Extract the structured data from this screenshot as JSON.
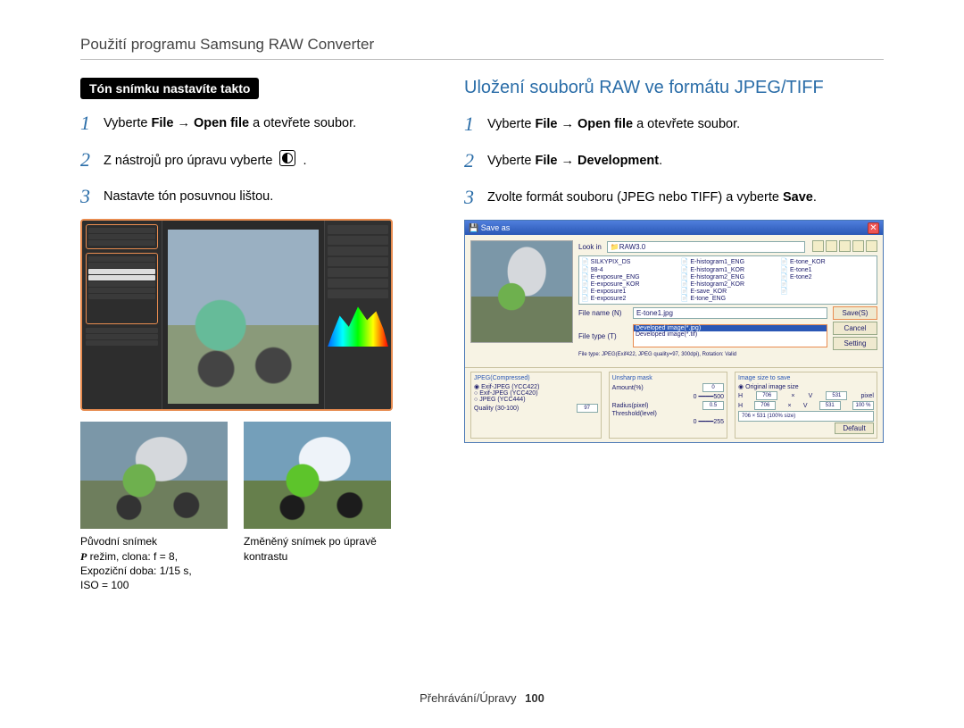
{
  "section_title": "Použití programu Samsung RAW Converter",
  "left": {
    "pill": "Tón snímku nastavíte takto",
    "steps": [
      {
        "prefix": "Vyberte ",
        "b1": "File",
        "arrow": " → ",
        "b2": "Open file",
        "suffix": " a otevřete soubor."
      },
      {
        "text_before": "Z nástrojů pro úpravu vyberte ",
        "text_after": " ."
      },
      {
        "plain": "Nastavte tón posuvnou lištou."
      }
    ],
    "thumb1": {
      "caption_l1": "Původní snímek",
      "caption_l2_prefix": "",
      "mode": "P",
      "caption_l2_rest": " režim, clona: f = 8,",
      "caption_l3": "Expoziční doba: 1/15 s,",
      "caption_l4": "ISO = 100"
    },
    "thumb2": {
      "caption_l1": "Změněný snímek po úpravě",
      "caption_l2": "kontrastu"
    }
  },
  "right": {
    "heading": "Uložení souborů RAW ve formátu JPEG/TIFF",
    "steps": [
      {
        "prefix": "Vyberte ",
        "b1": "File",
        "arrow": " → ",
        "b2": "Open file",
        "suffix": " a otevřete soubor."
      },
      {
        "prefix": "Vyberte ",
        "b1": "File",
        "arrow": " → ",
        "b2": "Development",
        "suffix": "."
      },
      {
        "text_before": "Zvolte formát souboru (JPEG nebo TIFF) a vyberte ",
        "bold": "Save",
        "text_after": "."
      }
    ],
    "dialog": {
      "title": "Save as",
      "lookin_label": "Look in",
      "lookin_value": "RAW3.0",
      "files": [
        "SILKYPIX_DS",
        "E-histogram1_ENG",
        "E-tone_KOR",
        "98-4",
        "E-histogram1_KOR",
        "E-tone1",
        "E-exposure_ENG",
        "E-histogram2_ENG",
        "E-tone2",
        "E-exposure_KOR",
        "E-histogram2_KOR",
        "",
        "E-exposure1",
        "E-save_KOR",
        "",
        "E-exposure2",
        "E-tone_ENG",
        ""
      ],
      "filename_label": "File name (N)",
      "filename_value": "E-tone1.jpg",
      "filetype_label": "File type (T)",
      "filetype_selected": "Developed image(*.jpg)",
      "filetype_alt": "Developed image(*.tif)",
      "save_btn": "Save(S)",
      "cancel_btn": "Cancel",
      "setting_btn": "Setting",
      "jpeg_info": "JPEG(Compressed)",
      "jpeg_sub": "File type: JPEG(Exif422, JPEG quality=97, 300dpi), Rotation: Valid",
      "jpeg_opts": [
        "Exif-JPEG  (YCC422)",
        "Exif-JPEG  (YCC420)",
        "JPEG  (YCC444)"
      ],
      "quality_label": "Quality (30-100)",
      "quality_val": "97",
      "unsharp_label": "Unsharp mask",
      "unsharp_amount": "Amount(%)",
      "unsharp_amount_v": "0",
      "unsharp_radius": "Radius(pixel)",
      "unsharp_radius_v": "0.5",
      "unsharp_thresh": "Threshold(level)",
      "unsharp_thresh_max": "500",
      "unsharp_thresh_max2": "255",
      "size_label": "Image size to save",
      "size_orig": "Original image size",
      "size_h": "H",
      "size_hv": "706",
      "size_v": "V",
      "size_vv": "531",
      "size_px": "pixel",
      "size_pct": "100 %",
      "size_text": "706 × 531 (100% size)",
      "default_btn": "Default"
    }
  },
  "footer_label": "Přehrávání/Úpravy",
  "footer_page": "100"
}
